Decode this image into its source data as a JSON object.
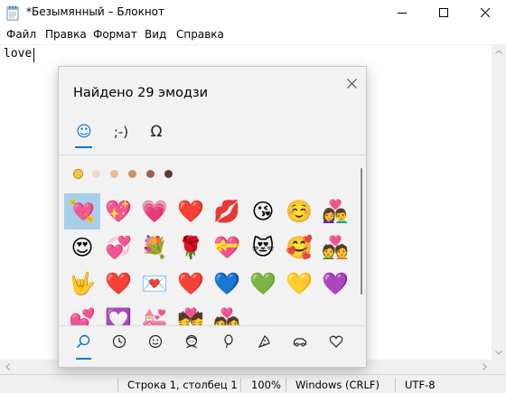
{
  "window": {
    "title": "*Безымянный – Блокнот"
  },
  "menu": {
    "items": [
      "Файл",
      "Правка",
      "Формат",
      "Вид",
      "Справка"
    ]
  },
  "editor": {
    "text": "love"
  },
  "statusbar": {
    "position": "Строка 1, столбец 1",
    "zoom": "100%",
    "line_endings": "Windows (CRLF)",
    "encoding": "UTF-8"
  },
  "emoji_panel": {
    "title": "Найдено 29 эмодзи",
    "category_tabs": [
      {
        "label": "☺",
        "icon": "smiley-icon",
        "active": true
      },
      {
        "label": ";-)",
        "icon": "kaomoji-icon",
        "active": false
      },
      {
        "label": "Ω",
        "icon": "symbols-icon",
        "active": false
      }
    ],
    "skin_tones": [
      "#f7c843",
      "#f6d7c5",
      "#e8bc9b",
      "#c69269",
      "#9c6541",
      "#5c3b2a"
    ],
    "emoji_rows": [
      [
        "💘",
        "💖",
        "💗",
        "❤️",
        "💋",
        "😘",
        "☺️",
        "👩‍❤️‍👨"
      ],
      [
        "😍",
        "💞",
        "💐",
        "🌹",
        "💝",
        "😻",
        "🥰",
        "💑"
      ],
      [
        "🤟",
        "❤️",
        "💌",
        "❤️",
        "💙",
        "💚",
        "💛",
        "💜"
      ],
      [
        "💕",
        "💟",
        "💒",
        "💏",
        "💑",
        "",
        "",
        ""
      ]
    ],
    "selected_emoji_index": 0,
    "bottom_tabs": [
      {
        "icon": "search-icon",
        "active": true
      },
      {
        "icon": "recent-clock-icon",
        "active": false
      },
      {
        "icon": "smiley-face-icon",
        "active": false
      },
      {
        "icon": "people-icon",
        "active": false
      },
      {
        "icon": "celebration-balloon-icon",
        "active": false
      },
      {
        "icon": "food-pizza-icon",
        "active": false
      },
      {
        "icon": "transport-car-icon",
        "active": false
      },
      {
        "icon": "heart-icon",
        "active": false
      }
    ],
    "accent_color": "#0078d7",
    "selection_color": "#a8cfe9"
  }
}
